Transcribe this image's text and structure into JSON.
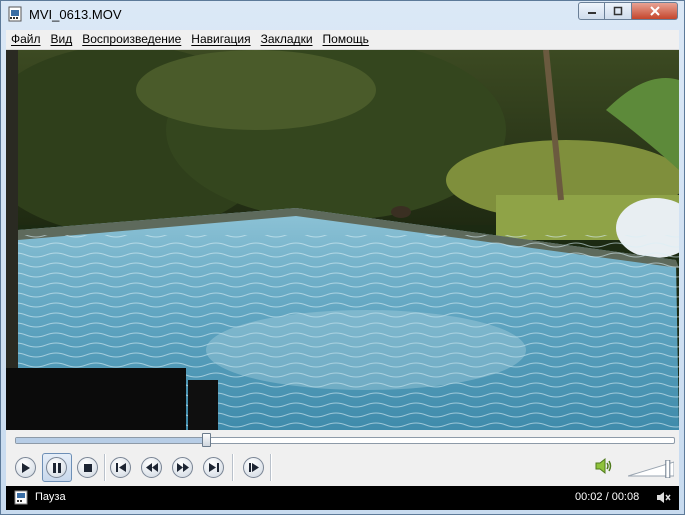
{
  "window": {
    "title": "MVI_0613.MOV"
  },
  "menu": {
    "items": [
      {
        "label": "Файл"
      },
      {
        "label": "Вид"
      },
      {
        "label": "Воспроизведение"
      },
      {
        "label": "Навигация"
      },
      {
        "label": "Закладки"
      },
      {
        "label": "Помощь"
      }
    ]
  },
  "playback": {
    "state": "Пауза",
    "current_time": "00:02",
    "total_time": "00:08",
    "time_display": "00:02 / 00:08",
    "progress_fraction": 0.29,
    "volume_fraction": 0.9
  },
  "icons": {
    "play": "play-icon",
    "pause": "pause-icon",
    "stop": "stop-icon",
    "previous": "skip-previous-icon",
    "rewind": "rewind-icon",
    "forward": "fast-forward-icon",
    "next": "skip-next-icon",
    "step": "frame-step-icon",
    "volume": "speaker-icon"
  },
  "colors": {
    "status_bar": "#000000",
    "accent": "#6d8fb6"
  }
}
